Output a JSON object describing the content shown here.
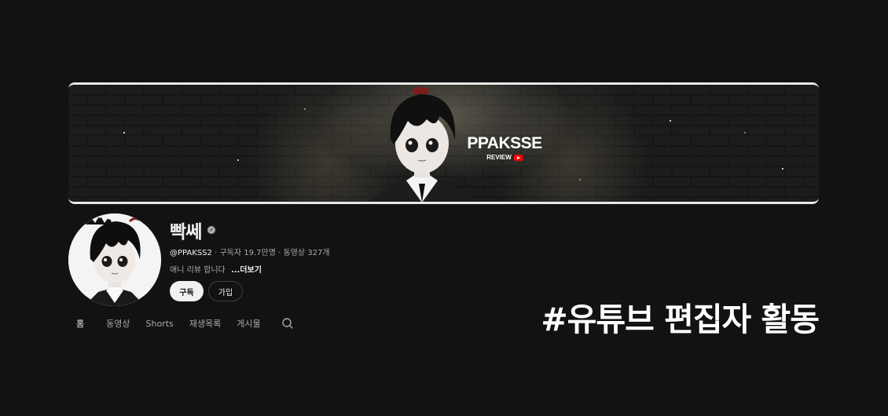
{
  "banner": {
    "logo_title": "PPAKSSE",
    "logo_sub": "REVIEW",
    "logo_icon": "youtube-icon"
  },
  "channel": {
    "name": "빡쎄",
    "verified_icon": "check-icon",
    "handle": "@PPAKSS2",
    "subscribers": "구독자 19.7만명",
    "videos": "동영상 327개",
    "separator": "·",
    "description": "애니 리뷰 합니다",
    "more_label": "...더보기"
  },
  "buttons": {
    "subscribe": "구독",
    "join": "가입"
  },
  "tabs": [
    {
      "label": "홈",
      "active": true
    },
    {
      "label": "동영상"
    },
    {
      "label": "Shorts"
    },
    {
      "label": "재생목록"
    },
    {
      "label": "게시물"
    }
  ],
  "tabs_search_icon": "search-icon",
  "caption": "#유튜브 편집자 활동",
  "colors": {
    "background": "#121212",
    "text_primary": "#f1f1f1",
    "text_secondary": "#aaaaaa",
    "youtube_red": "#ff0000"
  }
}
